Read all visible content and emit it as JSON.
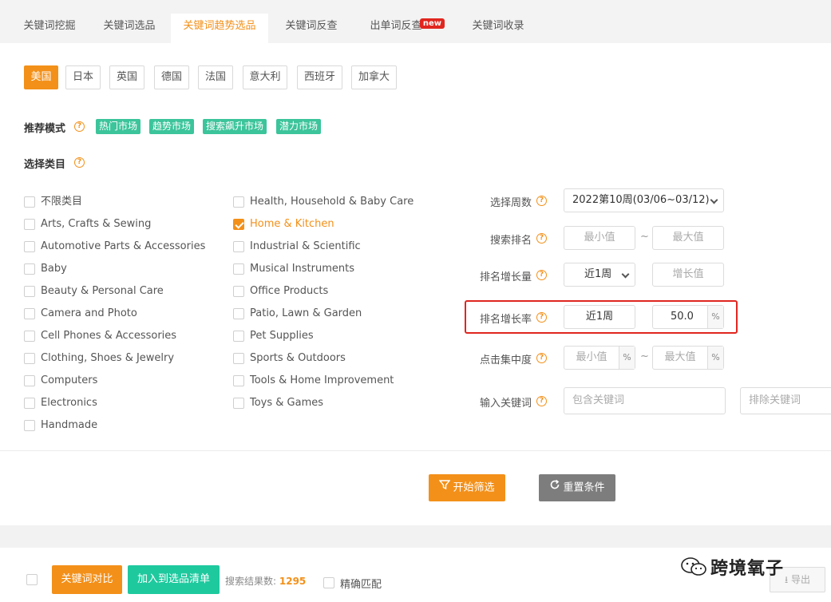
{
  "tabs": [
    {
      "label": "关键词挖掘"
    },
    {
      "label": "关键词选品"
    },
    {
      "label": "关键词趋势选品"
    },
    {
      "label": "关键词反查"
    },
    {
      "label": "出单词反查",
      "badge": "new"
    },
    {
      "label": "关键词收录"
    }
  ],
  "active_tab": "关键词趋势选品",
  "countries": [
    "美国",
    "日本",
    "英国",
    "德国",
    "法国",
    "意大利",
    "西班牙",
    "加拿大"
  ],
  "selected_country": "美国",
  "recommend": {
    "label": "推荐模式",
    "tags": [
      "热门市场",
      "趋势市场",
      "搜索飙升市场",
      "潜力市场"
    ]
  },
  "category": {
    "label": "选择类目",
    "left": [
      "不限类目",
      "Arts, Crafts & Sewing",
      "Automotive Parts & Accessories",
      "Baby",
      "Beauty & Personal Care",
      "Camera and Photo",
      "Cell Phones & Accessories",
      "Clothing, Shoes & Jewelry",
      "Computers",
      "Electronics",
      "Handmade"
    ],
    "right": [
      "Health, Household & Baby Care",
      "Home & Kitchen",
      "Industrial & Scientific",
      "Musical Instruments",
      "Office Products",
      "Patio, Lawn & Garden",
      "Pet Supplies",
      "Sports & Outdoors",
      "Tools & Home Improvement",
      "Toys & Games"
    ],
    "checked": "Home & Kitchen"
  },
  "filters": {
    "week_label": "选择周数",
    "week_value": "2022第10周(03/06~03/12)",
    "rank_label": "搜索排名",
    "rank_min_ph": "最小值",
    "rank_max_ph": "最大值",
    "growth_label": "排名增长量",
    "growth_period": "近1周",
    "growth_value_ph": "增长值",
    "rate_label": "排名增长率",
    "rate_period": "近1周",
    "rate_value": "50.0",
    "pct": "%",
    "click_label": "点击集中度",
    "click_min_ph": "最小值",
    "click_max_ph": "最大值",
    "keyword_label": "输入关键词",
    "include_ph": "包含关键词",
    "exclude_ph": "排除关键词",
    "dash": "~"
  },
  "actions": {
    "start": "开始筛选",
    "reset": "重置条件"
  },
  "bottom": {
    "compare": "关键词对比",
    "add_list": "加入到选品清单",
    "result_label": "搜索结果数:",
    "result_count": "1295",
    "exact": "精确匹配",
    "watermark": "跨境氧子",
    "export": "导出"
  },
  "colors": {
    "accent": "#f39019",
    "green": "#3cc49a",
    "red": "#e0261f"
  }
}
